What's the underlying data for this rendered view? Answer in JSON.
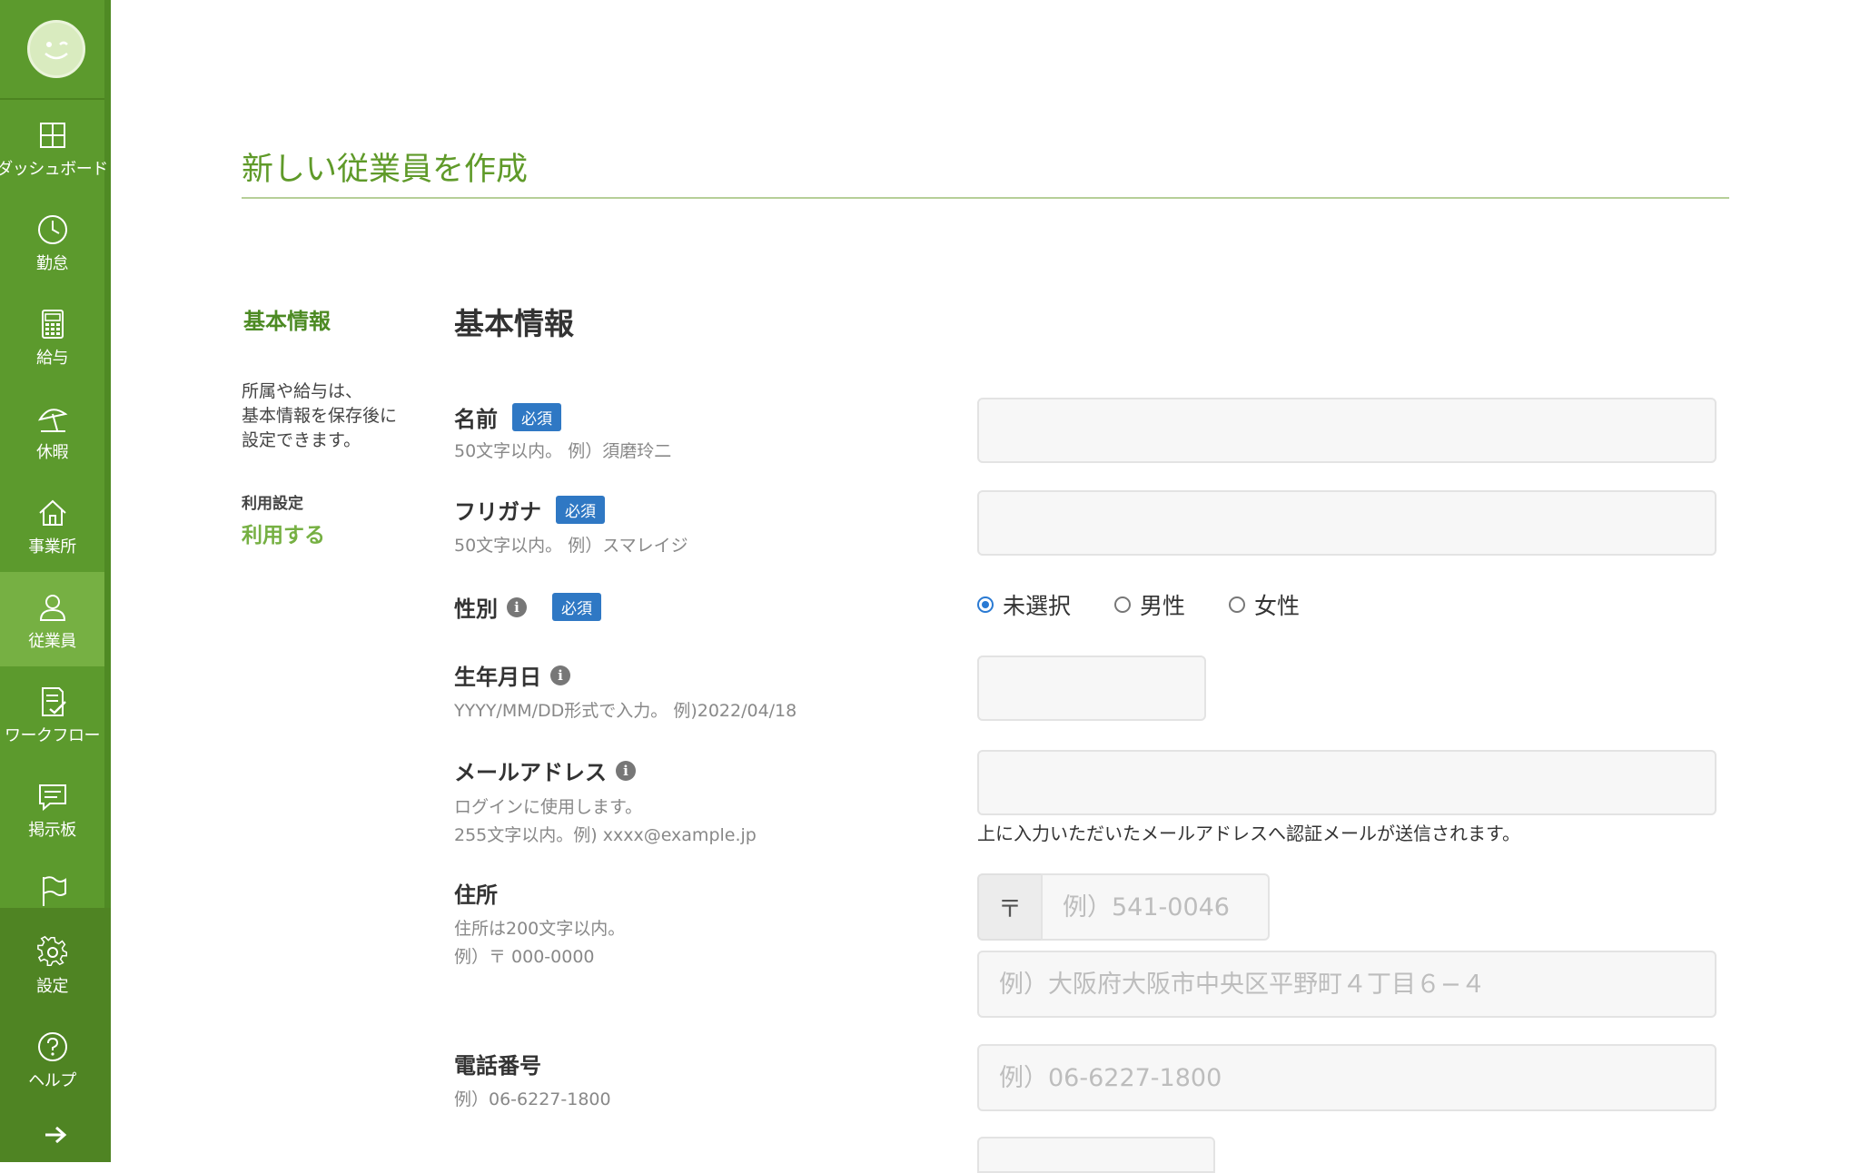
{
  "sidebar": {
    "items": [
      {
        "label": "ダッシュボード",
        "icon": "dashboard-icon"
      },
      {
        "label": "勤怠",
        "icon": "clock-icon"
      },
      {
        "label": "給与",
        "icon": "calculator-icon"
      },
      {
        "label": "休暇",
        "icon": "beach-umbrella-icon"
      },
      {
        "label": "事業所",
        "icon": "home-icon"
      },
      {
        "label": "従業員",
        "icon": "user-icon",
        "active": true
      },
      {
        "label": "ワークフロー",
        "icon": "checklist-icon"
      },
      {
        "label": "掲示板",
        "icon": "message-icon"
      },
      {
        "label": "",
        "icon": "flag-icon"
      },
      {
        "label": "設定",
        "icon": "gear-icon"
      },
      {
        "label": "ヘルプ",
        "icon": "help-icon"
      }
    ],
    "expand_icon": "arrow-right-icon",
    "accent": "#5c9a2d",
    "active_bg": "#76b043"
  },
  "page": {
    "title": "新しい従業員を作成"
  },
  "side_panel": {
    "heading": "基本情報",
    "note": "所属や給与は、\n基本情報を保存後に\n設定できます。",
    "usage_label": "利用設定",
    "usage_value": "利用する"
  },
  "form": {
    "section_title": "基本情報",
    "required_badge": "必須",
    "name": {
      "label": "名前",
      "hint": "50文字以内。 例）須磨玲二",
      "value": ""
    },
    "furigana": {
      "label": "フリガナ",
      "hint": "50文字以内。 例）スマレイジ",
      "value": ""
    },
    "gender": {
      "label": "性別",
      "options": [
        "未選択",
        "男性",
        "女性"
      ],
      "selected": "未選択"
    },
    "birthday": {
      "label": "生年月日",
      "hint": "YYYY/MM/DD形式で入力。 例)2022/04/18",
      "value": ""
    },
    "email": {
      "label": "メールアドレス",
      "hint1": "ログインに使用します。",
      "hint2": "255文字以内。例) xxxx@example.jp",
      "note": "上に入力いただいたメールアドレスへ認証メールが送信されます。",
      "value": ""
    },
    "address": {
      "label": "住所",
      "hint1": "住所は200文字以内。",
      "hint2": "例）〒 000-0000",
      "postal_prefix": "〒",
      "postal_placeholder": "例）541-0046",
      "address_placeholder": "例）大阪府大阪市中央区平野町４丁目６−４"
    },
    "phone": {
      "label": "電話番号",
      "hint": "例）06-6227-1800",
      "placeholder": "例）06-6227-1800"
    }
  }
}
